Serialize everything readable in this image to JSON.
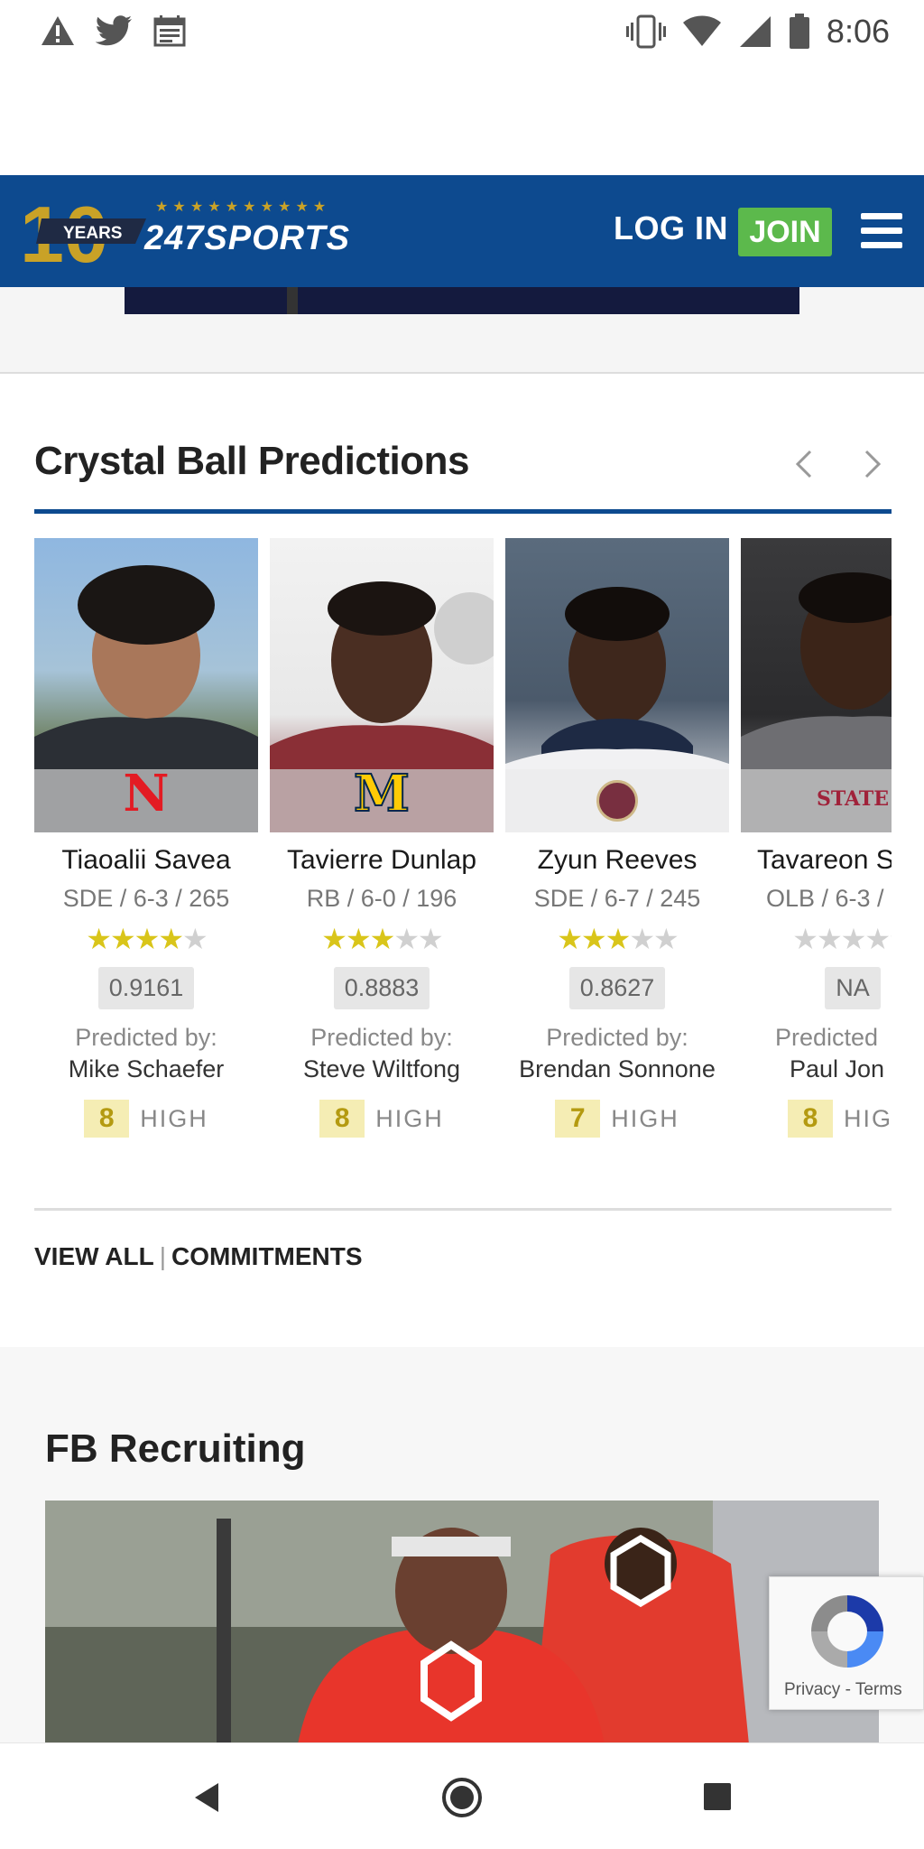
{
  "status_bar": {
    "time": "8:06",
    "left_icons": [
      "warning-icon",
      "twitter-icon",
      "calendar-icon"
    ],
    "right_icons": [
      "vibrate-icon",
      "wifi-icon",
      "signal-icon",
      "battery-icon"
    ]
  },
  "header": {
    "logo_years_number": "10",
    "logo_years_label": "YEARS",
    "logo_brand": "247SPORTS",
    "login_label": "LOG IN",
    "join_label": "JOIN",
    "brand_color": "#0d4a8f",
    "join_color": "#5cb94c"
  },
  "crystal_ball": {
    "title": "Crystal Ball Predictions",
    "predicted_by_label": "Predicted by:",
    "players": [
      {
        "name": "Tiaoalii Savea",
        "meta": "SDE / 6-3 / 265",
        "stars": 4,
        "rating": "0.9161",
        "predictor": "Mike Schaefer",
        "confidence": "8",
        "level": "HIGH",
        "team_logo": "N",
        "team_color": "#e31b23"
      },
      {
        "name": "Tavierre Dunlap",
        "meta": "RB / 6-0 / 196",
        "stars": 3,
        "rating": "0.8883",
        "predictor": "Steve Wiltfong",
        "confidence": "8",
        "level": "HIGH",
        "team_logo": "M",
        "team_color": "#ffcb05"
      },
      {
        "name": "Zyun Reeves",
        "meta": "SDE / 6-7 / 245",
        "stars": 3,
        "rating": "0.8627",
        "predictor": "Brendan Sonnone",
        "confidence": "7",
        "level": "HIGH",
        "team_logo": "fsu-seminole-logo",
        "team_color": "#782f40"
      },
      {
        "name": "Tavareon S",
        "meta": "OLB / 6-3 /",
        "stars": 0,
        "rating": "NA",
        "predictor": "Paul Jon",
        "predicted_by_partial": "Predicted",
        "confidence": "8",
        "level": "HIG",
        "team_logo": "STATE",
        "team_color": "#a0223a"
      }
    ],
    "links": {
      "view_all": "VIEW ALL",
      "separator": "|",
      "commitments": "COMMITMENTS"
    }
  },
  "fb_recruiting": {
    "title": "FB Recruiting"
  },
  "recaptcha": {
    "privacy": "Privacy",
    "dash": "-",
    "terms": "Terms"
  }
}
